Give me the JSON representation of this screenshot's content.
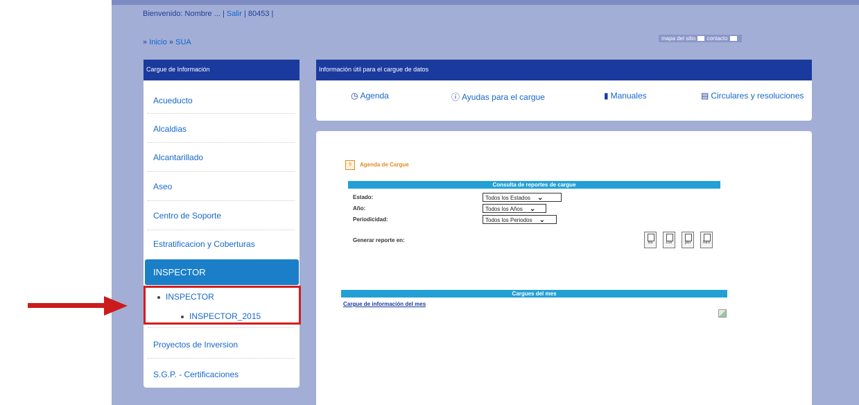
{
  "header": {
    "welcome_prefix": "Bienvenido: Nombre ... | ",
    "logout": "Salir",
    "user_id": " | 80453 |",
    "breadcrumb_prefix": "» ",
    "breadcrumb_home": "Inicio",
    "breadcrumb_sep": " » ",
    "breadcrumb_current": "SUA",
    "sitemap_link": "mapa del sitio",
    "contact_link": "contacto"
  },
  "sidebar": {
    "title": "Cargue de Información",
    "items": [
      {
        "label": "Acueducto"
      },
      {
        "label": "Alcaldias"
      },
      {
        "label": "Alcantarillado"
      },
      {
        "label": "Aseo"
      },
      {
        "label": "Centro de Soporte"
      },
      {
        "label": "Estratificacion y Coberturas"
      }
    ],
    "active": "INSPECTOR",
    "sub_items": [
      "INSPECTOR",
      "INSPECTOR_2015"
    ],
    "items_after": [
      {
        "label": "Proyectos de Inversion"
      },
      {
        "label": "S.G.P. - Certificaciones"
      }
    ]
  },
  "info_panel": {
    "title": "Información útil para el cargue de datos",
    "links": [
      {
        "icon": "clock-icon",
        "glyph": "🕘",
        "label": "Agenda"
      },
      {
        "icon": "help-icon",
        "glyph": "?",
        "label": "Ayudas para el cargue"
      },
      {
        "icon": "book-icon",
        "glyph": "📘",
        "label": "Manuales"
      },
      {
        "icon": "newspaper-icon",
        "glyph": "📰",
        "label": "Circulares y resoluciones"
      }
    ]
  },
  "main": {
    "agenda_title": "Agenda de Cargue",
    "agenda_icon_text": "9",
    "query_bar_title": "Consulta de reportes de cargue",
    "filters": [
      {
        "label": "Estado:",
        "value": "Todos los Estados"
      },
      {
        "label": "Año:",
        "value": "Todos los Años"
      },
      {
        "label": "Periodicidad:",
        "value": "Todos los Periodos"
      }
    ],
    "report_label": "Generar reporte en:",
    "formats": [
      "xls",
      "csv",
      "pdf",
      "htm"
    ],
    "month_bar_title": "Cargues del mes",
    "month_link": "Cargue de información del mes"
  },
  "colors": {
    "page_bg": "#a3aed6",
    "panel_header": "#1a3a9e",
    "active_item": "#1a7fc8",
    "section_bar": "#22a0d6",
    "annotation_red": "#d41c1c"
  }
}
